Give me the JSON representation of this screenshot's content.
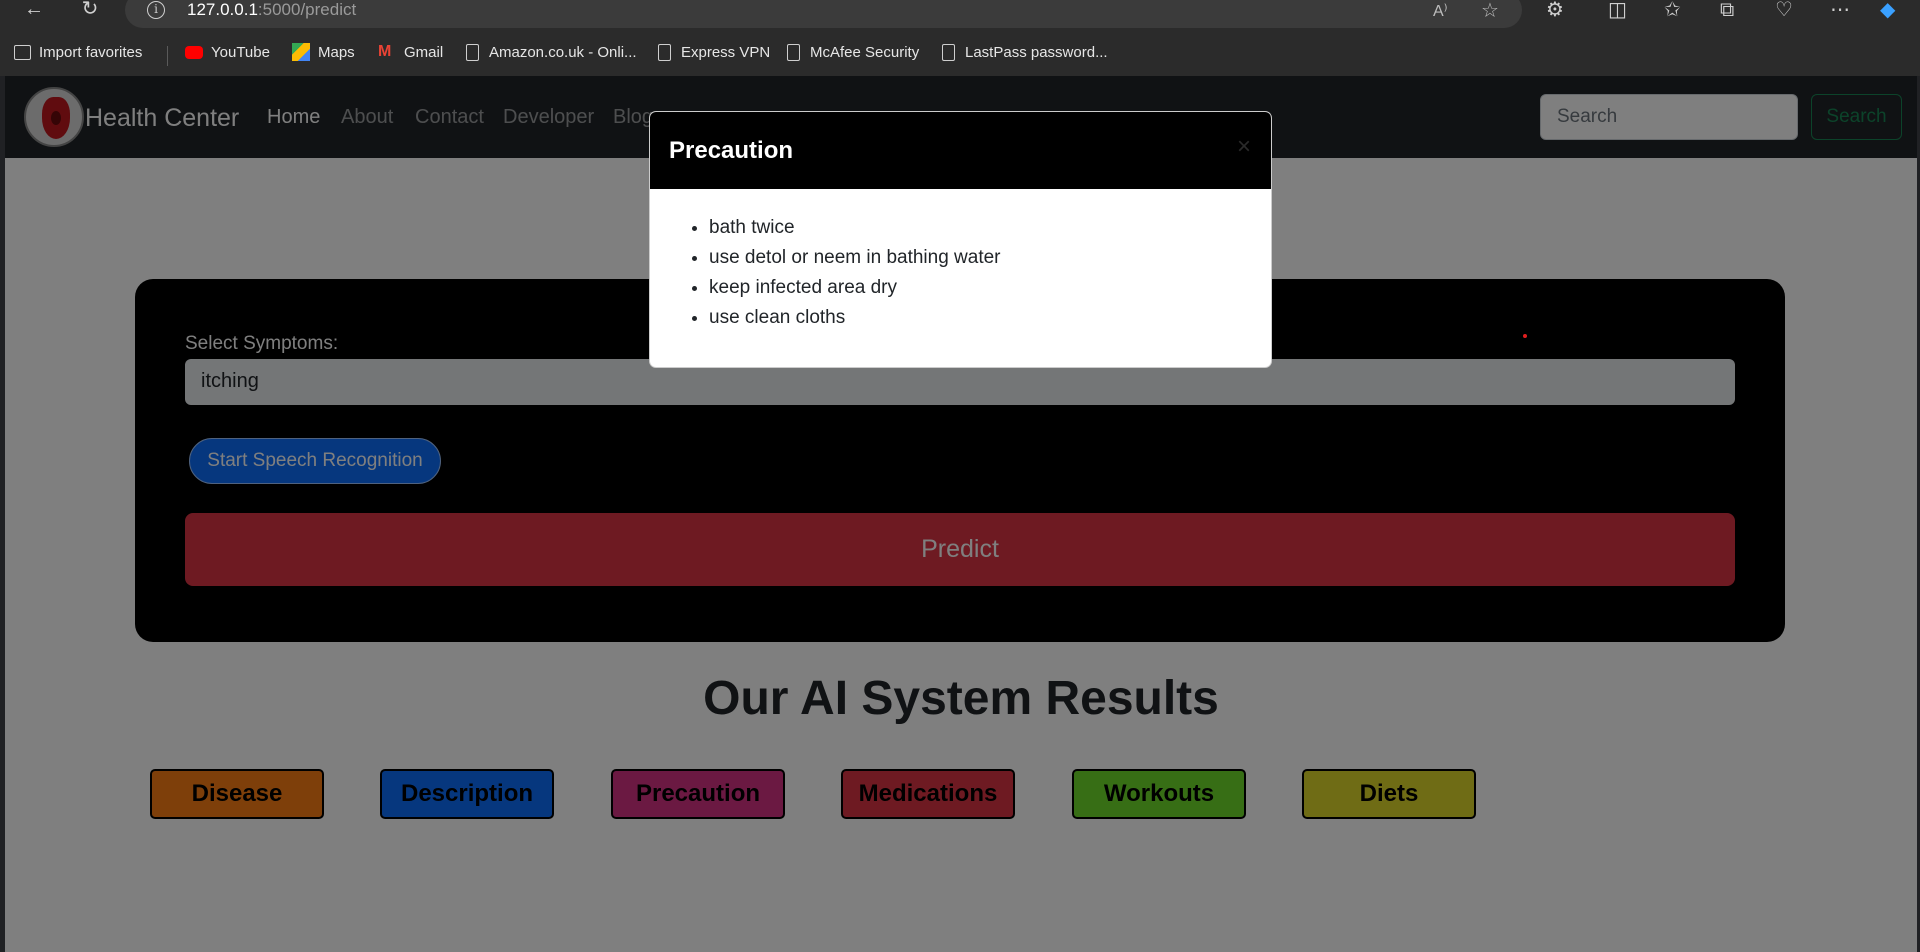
{
  "browser": {
    "url_host": "127.0.0.1",
    "url_path": ":5000/predict",
    "favorites": [
      {
        "label": "Import favorites",
        "icon": "import-favorites-icon"
      },
      {
        "label": "YouTube",
        "icon": "youtube-icon"
      },
      {
        "label": "Maps",
        "icon": "maps-icon"
      },
      {
        "label": "Gmail",
        "icon": "gmail-icon"
      },
      {
        "label": "Amazon.co.uk - Onli...",
        "icon": "page-icon"
      },
      {
        "label": "Express VPN",
        "icon": "page-icon"
      },
      {
        "label": "McAfee Security",
        "icon": "page-icon"
      },
      {
        "label": "LastPass password...",
        "icon": "page-icon"
      }
    ]
  },
  "navbar": {
    "brand": "Health Center",
    "links": [
      "Home",
      "About",
      "Contact",
      "Developer",
      "Blog"
    ],
    "search_placeholder": "Search",
    "search_button": "Search"
  },
  "form": {
    "label": "Select Symptoms:",
    "symptoms_value": "itching",
    "speech_button": "Start Speech Recognition",
    "predict_button": "Predict"
  },
  "results": {
    "title": "Our AI System Results",
    "buttons": [
      {
        "label": "Disease",
        "color": "#fd7e14"
      },
      {
        "label": "Description",
        "color": "#0d6efd"
      },
      {
        "label": "Precaution",
        "color": "#d63384"
      },
      {
        "label": "Medications",
        "color": "#dc3545"
      },
      {
        "label": "Workouts",
        "color": "#6fdc2b"
      },
      {
        "label": "Diets",
        "color": "#dfd82a"
      }
    ]
  },
  "modal": {
    "title": "Precaution",
    "close": "×",
    "items": [
      "bath twice",
      "use detol or neem in bathing water",
      "keep infected area dry",
      "use clean cloths"
    ]
  }
}
